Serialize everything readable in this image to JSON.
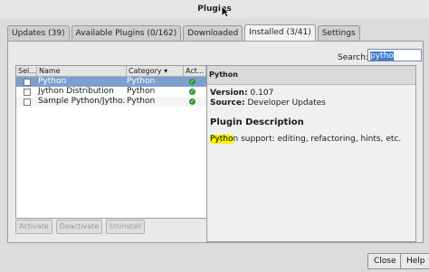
{
  "window": {
    "title": "Plugins"
  },
  "tabs": [
    {
      "label": "Updates (39)"
    },
    {
      "label": "Available Plugins (0/162)"
    },
    {
      "label": "Downloaded"
    },
    {
      "label": "Installed (3/41)"
    },
    {
      "label": "Settings"
    }
  ],
  "search": {
    "label": "Search:",
    "value": "pytho"
  },
  "table": {
    "columns": [
      "Sel...",
      "Name",
      "Category",
      "Act..."
    ],
    "rows": [
      {
        "name": "Python",
        "category": "Python",
        "selected": true
      },
      {
        "name": "Jython Distribution",
        "category": "Python",
        "selected": false
      },
      {
        "name": "Sample Python/Jytho...",
        "category": "Python",
        "selected": false
      }
    ]
  },
  "details": {
    "header": "Python",
    "version_label": "Version:",
    "version_value": "0.107",
    "source_label": "Source:",
    "source_value": "Developer Updates",
    "section_title": "Plugin Description",
    "desc_highlight": "Pytho",
    "desc_rest": "n support: editing, refactoring, hints, etc."
  },
  "buttons": {
    "activate": "Activate",
    "deactivate": "Deactivate",
    "uninstall": "Uninstall",
    "close": "Close",
    "help": "Help"
  },
  "icons": {
    "cursor": "arrow-cursor-icon",
    "active": "green-check-icon"
  },
  "colors": {
    "selection": "#7d9fd0",
    "active": "#2e9a2e",
    "highlight": "#f7f200"
  }
}
